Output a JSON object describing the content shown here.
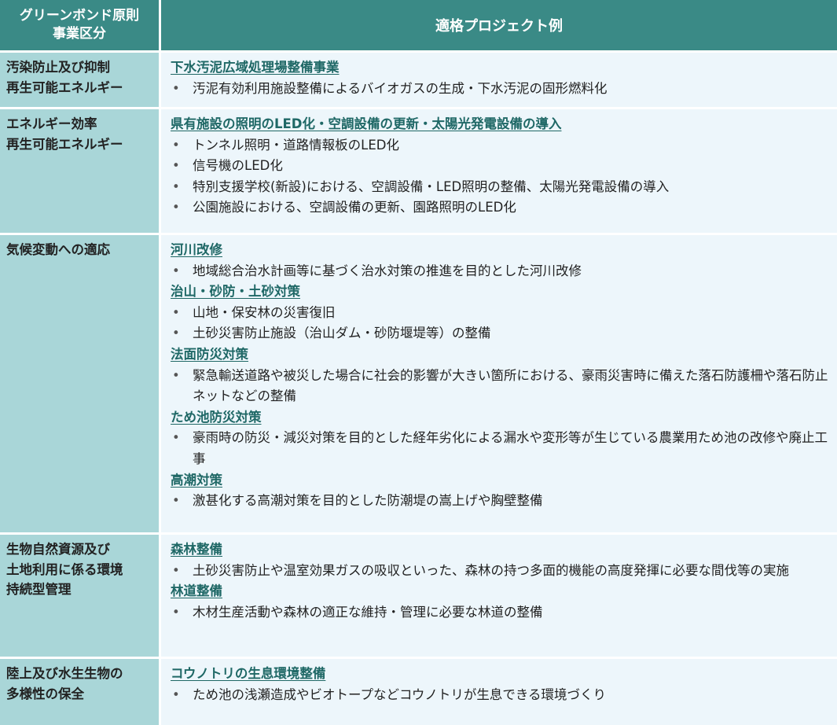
{
  "header": {
    "category_label_lines": [
      "グリーンボンド原則",
      "事業区分"
    ],
    "projects_label": "適格プロジェクト例"
  },
  "rows": [
    {
      "category_lines": [
        "汚染防止及び抑制",
        "再生可能エネルギー"
      ],
      "groups": [
        {
          "title": "下水汚泥広域処理場整備事業",
          "items": [
            "汚泥有効利用施設整備によるバイオガスの生成・下水汚泥の固形燃料化"
          ]
        }
      ]
    },
    {
      "category_lines": [
        "エネルギー効率",
        "再生可能エネルギー"
      ],
      "groups": [
        {
          "title": "県有施設の照明のLED化・空調設備の更新・太陽光発電設備の導入",
          "items": [
            "トンネル照明・道路情報板のLED化",
            "信号機のLED化",
            "特別支援学校(新設)における、空調設備・LED照明の整備、太陽光発電設備の導入",
            "公園施設における、空調設備の更新、園路照明のLED化"
          ]
        }
      ]
    },
    {
      "category_lines": [
        "気候変動への適応"
      ],
      "groups": [
        {
          "title": "河川改修",
          "items": [
            "地域総合治水計画等に基づく治水対策の推進を目的とした河川改修"
          ]
        },
        {
          "title": "治山・砂防・土砂対策",
          "items": [
            "山地・保安林の災害復旧",
            "土砂災害防止施設（治山ダム・砂防堰堤等）の整備"
          ]
        },
        {
          "title": "法面防災対策",
          "items": [
            "緊急輸送道路や被災した場合に社会的影響が大きい箇所における、豪雨災害時に備えた落石防護柵や落石防止ネットなどの整備"
          ]
        },
        {
          "title": "ため池防災対策",
          "items": [
            "豪雨時の防災・減災対策を目的とした経年劣化による漏水や変形等が生じている農業用ため池の改修や廃止工事"
          ]
        },
        {
          "title": "高潮対策",
          "items": [
            "激甚化する高潮対策を目的とした防潮堤の嵩上げや胸壁整備"
          ]
        }
      ]
    },
    {
      "category_lines": [
        "生物自然資源及び",
        "土地利用に係る環境",
        "持続型管理"
      ],
      "groups": [
        {
          "title": "森林整備",
          "items": [
            "土砂災害防止や温室効果ガスの吸収といった、森林の持つ多面的機能の高度発揮に必要な間伐等の実施"
          ]
        },
        {
          "title": "林道整備",
          "items": [
            "木材生産活動や森林の適正な維持・管理に必要な林道の整備"
          ]
        }
      ]
    },
    {
      "category_lines": [
        "陸上及び水生生物の",
        "多様性の保全"
      ],
      "groups": [
        {
          "title": "コウノトリの生息環境整備",
          "items": [
            "ため池の浅瀬造成やビオトープなどコウノトリが生息できる環境づくり"
          ]
        }
      ]
    }
  ],
  "colors": {
    "header_bg": "#3a8a86",
    "category_bg": "#a9d6d8",
    "project_bg": "#edf6fb",
    "title_text": "#1f6866"
  }
}
